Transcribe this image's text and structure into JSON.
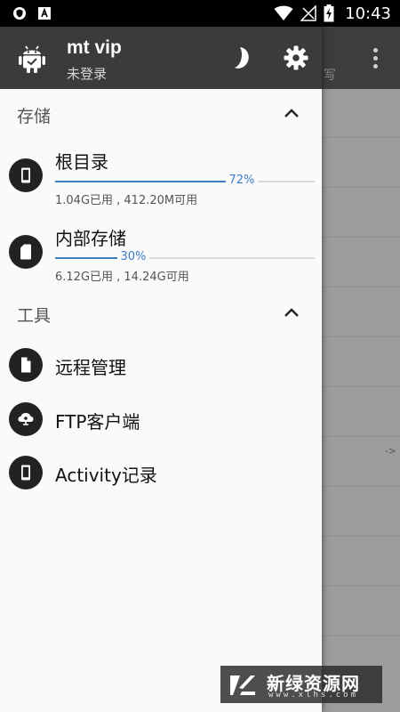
{
  "status_bar": {
    "time": "10:43",
    "left_icons": [
      "shield-icon",
      "a-icon"
    ],
    "right_icons": [
      "wifi-icon",
      "no-signal-icon",
      "battery-charging-icon"
    ]
  },
  "background_app": {
    "toolbar_fragment": "写",
    "arrow_text": "->"
  },
  "drawer": {
    "header": {
      "title": "mt vip",
      "subtitle": "未登录"
    },
    "storage_section": {
      "label": "存储",
      "items": [
        {
          "name": "根目录",
          "percent_text": "72%",
          "percent": 72,
          "info": "1.04G已用 , 412.20M可用"
        },
        {
          "name": "内部存储",
          "percent_text": "30%",
          "percent": 30,
          "info": "6.12G已用 , 14.24G可用"
        }
      ]
    },
    "tools_section": {
      "label": "工具",
      "items": [
        {
          "label": "远程管理"
        },
        {
          "label": "FTP客户端"
        },
        {
          "label": "Activity记录"
        }
      ]
    }
  },
  "watermark": {
    "text": "新绿资源网",
    "subtext": "www.xlhs.com"
  },
  "colors": {
    "accent": "#3d7cc4",
    "header": "#3b3b3b",
    "icon_circle": "#222222"
  }
}
